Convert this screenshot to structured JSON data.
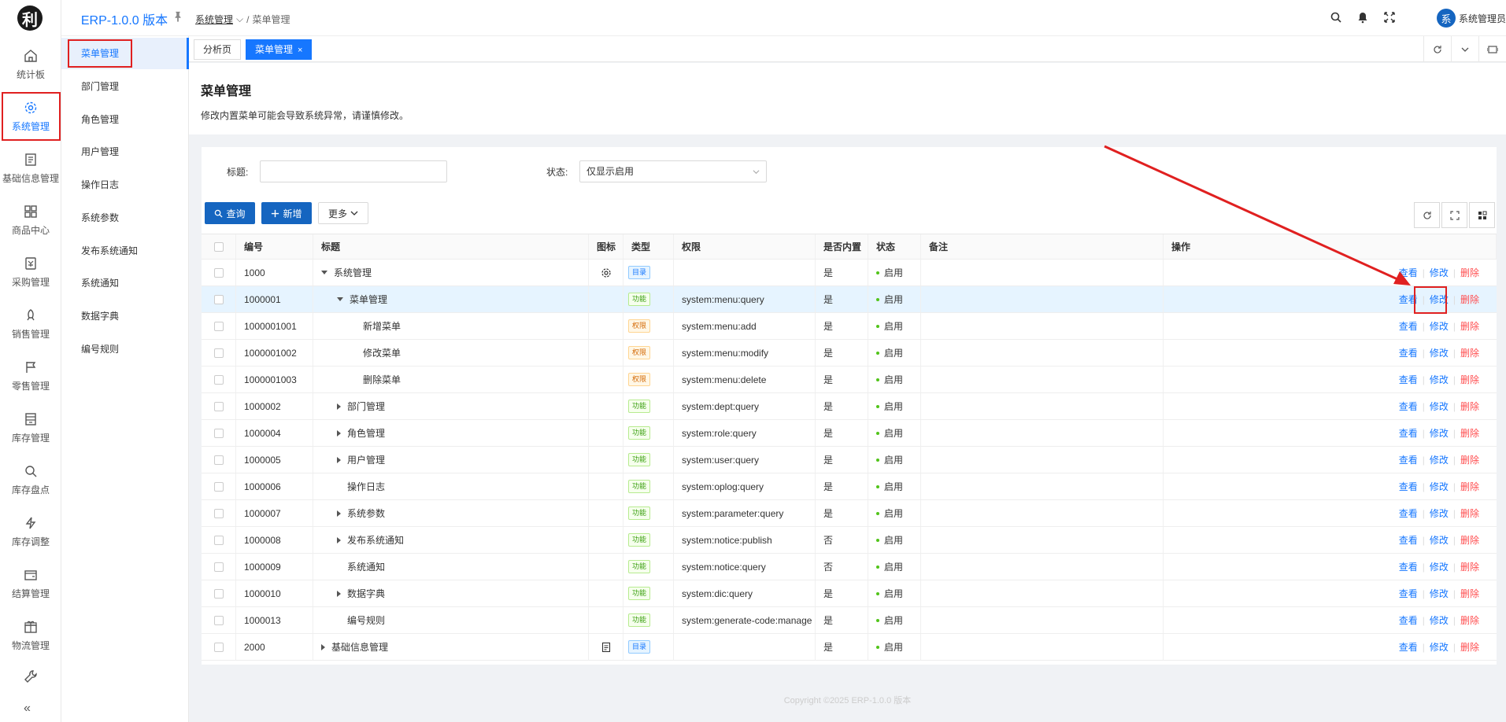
{
  "app": {
    "logo_char": "利",
    "brand": "ERP-1.0.0 版本"
  },
  "breadcrumb": {
    "parent": "系统管理",
    "current": "菜单管理"
  },
  "user": {
    "avatar_char": "系",
    "name": "系统管理员"
  },
  "rail": [
    {
      "label": "统计板",
      "icon": "home-icon"
    },
    {
      "label": "系统管理",
      "icon": "gear-icon",
      "active": true
    },
    {
      "label": "基础信息管理",
      "icon": "document-icon"
    },
    {
      "label": "商品中心",
      "icon": "grid-icon"
    },
    {
      "label": "采购管理",
      "icon": "purchase-icon"
    },
    {
      "label": "销售管理",
      "icon": "rocket-icon"
    },
    {
      "label": "零售管理",
      "icon": "flag-icon"
    },
    {
      "label": "库存管理",
      "icon": "inventory-icon"
    },
    {
      "label": "库存盘点",
      "icon": "search-icon"
    },
    {
      "label": "库存调整",
      "icon": "bolt-icon"
    },
    {
      "label": "结算管理",
      "icon": "wallet-icon"
    },
    {
      "label": "物流管理",
      "icon": "gift-icon"
    },
    {
      "label": "",
      "icon": "wrench-icon"
    }
  ],
  "rail_collapse": "«",
  "submenu": [
    "菜单管理",
    "部门管理",
    "角色管理",
    "用户管理",
    "操作日志",
    "系统参数",
    "发布系统通知",
    "系统通知",
    "数据字典",
    "编号规则"
  ],
  "tabs": [
    {
      "label": "分析页"
    },
    {
      "label": "菜单管理",
      "active": true,
      "close": "×"
    }
  ],
  "page": {
    "title": "菜单管理",
    "notice": "修改内置菜单可能会导致系统异常，请谨慎修改。"
  },
  "filters": {
    "title_label": "标题:",
    "title_value": "",
    "status_label": "状态:",
    "status_value": "仅显示启用"
  },
  "buttons": {
    "query": "查询",
    "add": "新增",
    "more": "更多"
  },
  "table": {
    "headers": [
      "编号",
      "标题",
      "图标",
      "类型",
      "权限",
      "是否内置",
      "状态",
      "备注",
      "操作"
    ],
    "actions": {
      "view": "查看",
      "edit": "修改",
      "del": "删除"
    },
    "rows": [
      {
        "id": "1000",
        "title": "系统管理",
        "level": 0,
        "expand": "down",
        "icon": "gear",
        "type": "目录",
        "tcls": "dir",
        "perm": "",
        "builtin": "是",
        "status": "启用"
      },
      {
        "id": "1000001",
        "title": "菜单管理",
        "level": 1,
        "expand": "down",
        "icon": "",
        "type": "功能",
        "tcls": "func",
        "perm": "system:menu:query",
        "builtin": "是",
        "status": "启用",
        "hl": true
      },
      {
        "id": "1000001001",
        "title": "新增菜单",
        "level": 2,
        "expand": "",
        "icon": "",
        "type": "权限",
        "tcls": "perm",
        "perm": "system:menu:add",
        "builtin": "是",
        "status": "启用"
      },
      {
        "id": "1000001002",
        "title": "修改菜单",
        "level": 2,
        "expand": "",
        "icon": "",
        "type": "权限",
        "tcls": "perm",
        "perm": "system:menu:modify",
        "builtin": "是",
        "status": "启用"
      },
      {
        "id": "1000001003",
        "title": "删除菜单",
        "level": 2,
        "expand": "",
        "icon": "",
        "type": "权限",
        "tcls": "perm",
        "perm": "system:menu:delete",
        "builtin": "是",
        "status": "启用"
      },
      {
        "id": "1000002",
        "title": "部门管理",
        "level": 1,
        "expand": "right",
        "icon": "",
        "type": "功能",
        "tcls": "func",
        "perm": "system:dept:query",
        "builtin": "是",
        "status": "启用"
      },
      {
        "id": "1000004",
        "title": "角色管理",
        "level": 1,
        "expand": "right",
        "icon": "",
        "type": "功能",
        "tcls": "func",
        "perm": "system:role:query",
        "builtin": "是",
        "status": "启用"
      },
      {
        "id": "1000005",
        "title": "用户管理",
        "level": 1,
        "expand": "right",
        "icon": "",
        "type": "功能",
        "tcls": "func",
        "perm": "system:user:query",
        "builtin": "是",
        "status": "启用"
      },
      {
        "id": "1000006",
        "title": "操作日志",
        "level": 1,
        "expand": "",
        "icon": "",
        "type": "功能",
        "tcls": "func",
        "perm": "system:oplog:query",
        "builtin": "是",
        "status": "启用"
      },
      {
        "id": "1000007",
        "title": "系统参数",
        "level": 1,
        "expand": "right",
        "icon": "",
        "type": "功能",
        "tcls": "func",
        "perm": "system:parameter:query",
        "builtin": "是",
        "status": "启用"
      },
      {
        "id": "1000008",
        "title": "发布系统通知",
        "level": 1,
        "expand": "right",
        "icon": "",
        "type": "功能",
        "tcls": "func",
        "perm": "system:notice:publish",
        "builtin": "否",
        "status": "启用"
      },
      {
        "id": "1000009",
        "title": "系统通知",
        "level": 1,
        "expand": "",
        "icon": "",
        "type": "功能",
        "tcls": "func",
        "perm": "system:notice:query",
        "builtin": "否",
        "status": "启用"
      },
      {
        "id": "1000010",
        "title": "数据字典",
        "level": 1,
        "expand": "right",
        "icon": "",
        "type": "功能",
        "tcls": "func",
        "perm": "system:dic:query",
        "builtin": "是",
        "status": "启用"
      },
      {
        "id": "1000013",
        "title": "编号规则",
        "level": 1,
        "expand": "",
        "icon": "",
        "type": "功能",
        "tcls": "func",
        "perm": "system:generate-code:manage",
        "builtin": "是",
        "status": "启用"
      },
      {
        "id": "2000",
        "title": "基础信息管理",
        "level": 0,
        "expand": "right",
        "icon": "doc",
        "type": "目录",
        "tcls": "dir",
        "perm": "",
        "builtin": "是",
        "status": "启用"
      }
    ]
  },
  "footer": "Copyright ©2025 ERP-1.0.0 版本",
  "colors": {
    "primary": "#1677ff",
    "annotation": "#e02020",
    "success": "#52c41a",
    "danger": "#ff4d4f"
  }
}
